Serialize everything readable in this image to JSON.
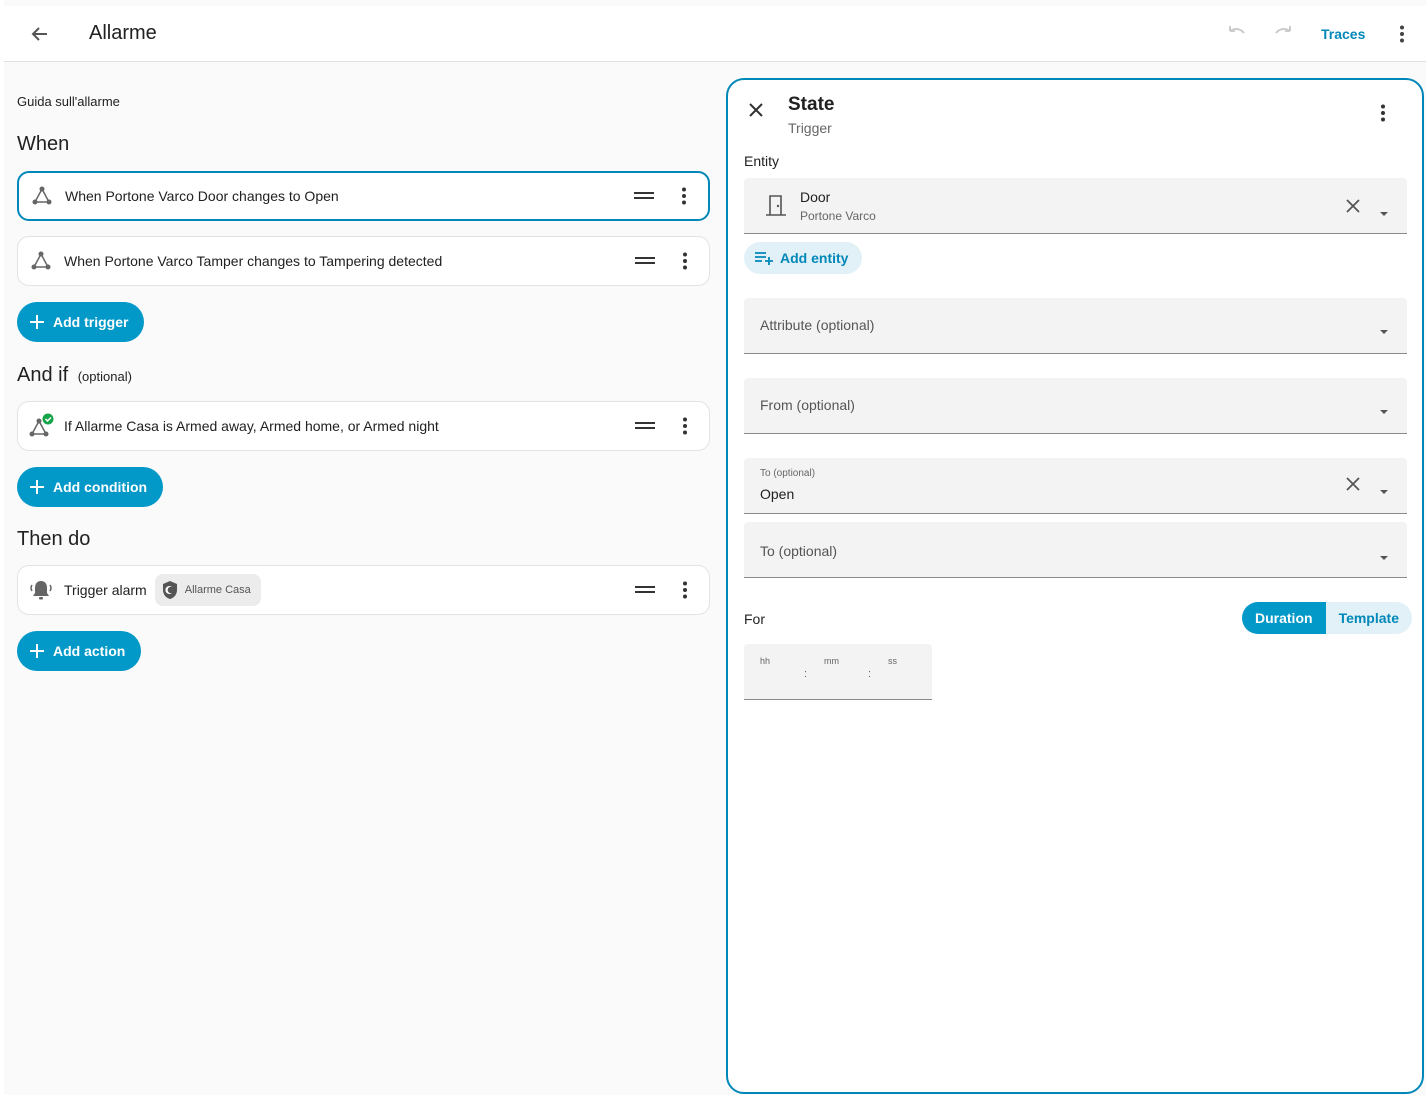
{
  "header": {
    "title": "Allarme",
    "traces_label": "Traces"
  },
  "editor": {
    "description": "Guida sull'allarme",
    "when": {
      "heading": "When",
      "triggers": [
        {
          "text": "When Portone Varco Door changes to Open"
        },
        {
          "text": "When Portone Varco Tamper changes to Tampering detected"
        }
      ],
      "add_label": "Add trigger"
    },
    "and_if": {
      "heading": "And if",
      "optional": "(optional)",
      "conditions": [
        {
          "text": "If Allarme Casa is Armed away, Armed home, or Armed night"
        }
      ],
      "add_label": "Add condition"
    },
    "then_do": {
      "heading": "Then do",
      "actions": [
        {
          "text": "Trigger alarm",
          "chip": "Allarme Casa"
        }
      ],
      "add_label": "Add action"
    }
  },
  "panel": {
    "title": "State",
    "subtitle": "Trigger",
    "entity_label": "Entity",
    "entity": {
      "name": "Door",
      "device": "Portone Varco"
    },
    "add_entity_label": "Add entity",
    "attribute_placeholder": "Attribute (optional)",
    "from_placeholder": "From (optional)",
    "to_label": "To (optional)",
    "to_value": "Open",
    "to2_placeholder": "To (optional)",
    "for_label": "For",
    "modes": {
      "duration": "Duration",
      "template": "Template"
    },
    "duration_units": {
      "hh": "hh",
      "mm": "mm",
      "ss": "ss",
      "sep": ":"
    }
  },
  "colors": {
    "accent": "#0298c8",
    "check": "#17a34a"
  }
}
